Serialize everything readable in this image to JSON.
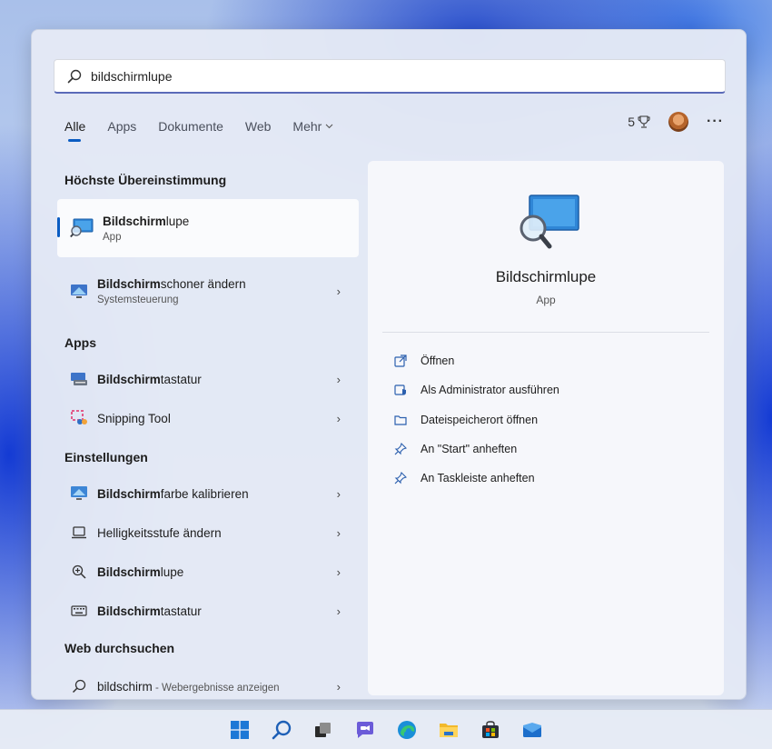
{
  "search": {
    "value": "bildschirmlupe",
    "placeholder": ""
  },
  "tabs": [
    {
      "label": "Alle"
    },
    {
      "label": "Apps"
    },
    {
      "label": "Dokumente"
    },
    {
      "label": "Web"
    },
    {
      "label": "Mehr"
    }
  ],
  "header": {
    "points": "5"
  },
  "sections": {
    "best_match": "Höchste Übereinstimmung",
    "apps": "Apps",
    "settings": "Einstellungen",
    "web": "Web durchsuchen"
  },
  "best_match": {
    "title_bold": "Bildschirm",
    "title_rest": "lupe",
    "subtitle": "App"
  },
  "results": {
    "screensaver": {
      "bold": "Bildschirm",
      "rest": "schoner ändern",
      "subtitle": "Systemsteuerung"
    },
    "keyboard_app": {
      "bold": "Bildschirm",
      "rest": "tastatur"
    },
    "snipping": {
      "bold": "",
      "rest": "Snipping Tool"
    },
    "calibrate": {
      "bold": "Bildschirm",
      "rest": "farbe kalibrieren"
    },
    "brightness": {
      "bold": "",
      "rest": "Helligkeitsstufe ändern"
    },
    "magnifier_setting": {
      "bold": "Bildschirm",
      "rest": "lupe"
    },
    "keyboard_setting": {
      "bold": "Bildschirm",
      "rest": "tastatur"
    },
    "web_search": {
      "bold": "bildschirm",
      "rest": " - Webergebnisse anzeigen"
    }
  },
  "detail": {
    "title": "Bildschirmlupe",
    "subtitle": "App",
    "actions": [
      {
        "label": "Öffnen"
      },
      {
        "label": "Als Administrator ausführen"
      },
      {
        "label": "Dateispeicherort öffnen"
      },
      {
        "label": "An \"Start\" anheften"
      },
      {
        "label": "An Taskleiste anheften"
      }
    ]
  },
  "colors": {
    "accent": "#0a5cc2"
  }
}
